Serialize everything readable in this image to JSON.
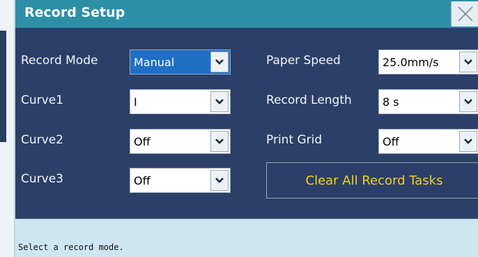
{
  "dialog": {
    "title": "Record Setup",
    "close_icon": "close-icon"
  },
  "fields": {
    "record_mode": {
      "label": "Record Mode",
      "value": "Manual"
    },
    "curve1": {
      "label": "Curve1",
      "value": "I"
    },
    "curve2": {
      "label": "Curve2",
      "value": "Off"
    },
    "curve3": {
      "label": "Curve3",
      "value": "Off"
    },
    "paper_speed": {
      "label": "Paper Speed",
      "value": "25.0mm/s"
    },
    "record_length": {
      "label": "Record Length",
      "value": "8 s"
    },
    "print_grid": {
      "label": "Print Grid",
      "value": "Off"
    }
  },
  "buttons": {
    "clear_all": "Clear All Record Tasks"
  },
  "status": {
    "message": "Select a record mode."
  },
  "colors": {
    "titlebar": "#2d8fa6",
    "dialog_bg": "#2c3f68",
    "selected_field": "#1f6fc6",
    "button_text": "#f6d21c",
    "status_bg": "#cde6f2"
  },
  "icons": {
    "dropdown": "chevron-down-icon",
    "close": "close-icon"
  }
}
